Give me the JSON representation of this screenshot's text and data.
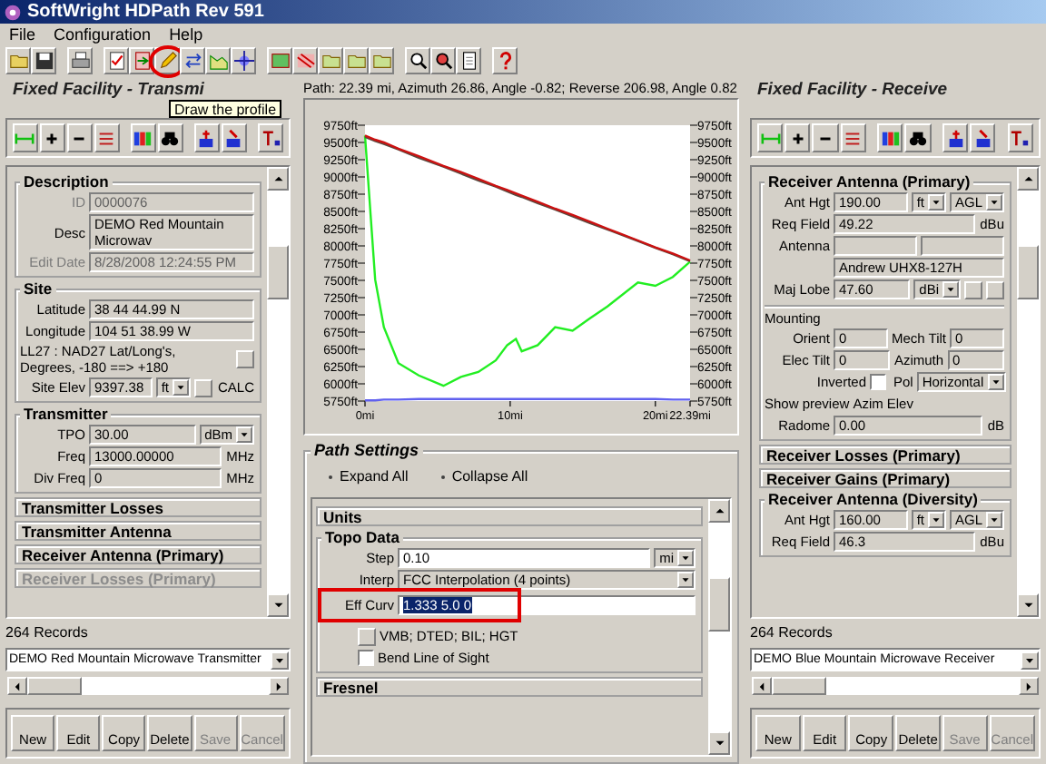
{
  "window": {
    "title": "SoftWright HDPath Rev 591"
  },
  "menu": [
    "File",
    "Configuration",
    "Help"
  ],
  "toolbar": {
    "tooltip": "Draw the profile",
    "highlighted": true
  },
  "transmit_panel": {
    "title": "Fixed Facility - Transmi",
    "sections": [
      {
        "title": "Description",
        "expanded": true,
        "disabled": false,
        "rows": [
          [
            {
              "kind": "label",
              "text": "ID",
              "disabled": true
            },
            {
              "kind": "input",
              "value": "0000076",
              "editable": false,
              "disabled": true
            }
          ],
          [
            {
              "kind": "label",
              "text": "Desc",
              "disabled": false
            },
            {
              "kind": "input",
              "value": "DEMO Red Mountain Microwav",
              "editable": false,
              "disabled": false
            }
          ],
          [
            {
              "kind": "label",
              "text": "Edit Date",
              "disabled": true
            },
            {
              "kind": "input",
              "value": "8/28/2008 12:24:55 PM",
              "editable": false,
              "disabled": true
            }
          ]
        ]
      },
      {
        "title": "Site",
        "expanded": true,
        "disabled": false,
        "rows": [
          [
            {
              "kind": "label",
              "text": "Latitude"
            },
            {
              "kind": "input",
              "value": "38 44 44.99 N",
              "editable": false
            }
          ],
          [
            {
              "kind": "label",
              "text": "Longitude"
            },
            {
              "kind": "input",
              "value": "104 51 38.99 W",
              "editable": false
            }
          ],
          [
            {
              "kind": "caption",
              "text": "LL27 : NAD27 Lat/Long's, Degrees, -180 ==> +180"
            },
            {
              "kind": "button"
            }
          ],
          [
            {
              "kind": "label",
              "text": "Site Elev"
            },
            {
              "kind": "input",
              "value": "9397.38",
              "editable": false
            },
            {
              "kind": "combo",
              "value": "ft"
            },
            {
              "kind": "button"
            },
            {
              "kind": "unit",
              "text": "CALC"
            }
          ]
        ]
      },
      {
        "title": "Transmitter",
        "expanded": true,
        "disabled": false,
        "rows": [
          [
            {
              "kind": "label",
              "text": "TPO"
            },
            {
              "kind": "input",
              "value": "30.00",
              "editable": false
            },
            {
              "kind": "combo",
              "value": "dBm"
            }
          ],
          [
            {
              "kind": "label",
              "text": "Freq"
            },
            {
              "kind": "input",
              "value": "13000.00000",
              "editable": false
            },
            {
              "kind": "unit",
              "text": "MHz"
            }
          ],
          [
            {
              "kind": "label",
              "text": "Div Freq"
            },
            {
              "kind": "input",
              "value": "0",
              "editable": false
            },
            {
              "kind": "unit",
              "text": "MHz"
            }
          ]
        ]
      },
      {
        "title": "Transmitter Losses",
        "expanded": false,
        "disabled": false
      },
      {
        "title": "Transmitter Antenna",
        "expanded": false,
        "disabled": false
      },
      {
        "title": "Receiver Antenna (Primary)",
        "expanded": false,
        "disabled": false
      },
      {
        "title": "Receiver Losses (Primary)",
        "expanded": false,
        "disabled": true
      }
    ],
    "records": "264 Records",
    "record": "DEMO Red Mountain Microwave Transmitter",
    "buttons": [
      {
        "label": "New",
        "disabled": false
      },
      {
        "label": "Edit",
        "disabled": false
      },
      {
        "label": "Copy",
        "disabled": false
      },
      {
        "label": "Delete",
        "disabled": false
      },
      {
        "label": "Save",
        "disabled": true
      },
      {
        "label": "Cancel",
        "disabled": true
      }
    ]
  },
  "profile": {
    "path_info": "Path: 22.39 mi, Azimuth 26.86, Angle -0.82; Reverse 206.98, Angle 0.82",
    "chart_data": {
      "type": "line",
      "x": [
        0,
        0.7,
        1.3,
        2.3,
        3.7,
        5.4,
        6.6,
        7.8,
        9,
        9.8,
        10.4,
        10.8,
        11.9,
        13.1,
        14.3,
        15.5,
        16.7,
        18.8,
        20,
        21.2,
        22.39
      ],
      "series": [
        {
          "color": "#22ee22",
          "values": [
            9600,
            7510,
            6820,
            6300,
            6120,
            5970,
            6100,
            6170,
            6340,
            6560,
            6650,
            6470,
            6560,
            6820,
            6770,
            6950,
            7120,
            7470,
            7420,
            7550,
            7770
          ]
        },
        {
          "color": "#5a4a40",
          "values": [
            9580,
            9520,
            9480,
            9400,
            9280,
            9150,
            9050,
            8950,
            8860,
            8790,
            8740,
            8710,
            8620,
            8530,
            8430,
            8330,
            8240,
            8070,
            7970,
            7880,
            7780
          ]
        },
        {
          "color": "#cc1111",
          "values": [
            9600,
            9540,
            9500,
            9410,
            9300,
            9160,
            9070,
            8970,
            8870,
            8810,
            8760,
            8730,
            8640,
            8540,
            8450,
            8350,
            8250,
            8080,
            7980,
            7890,
            7790
          ]
        },
        {
          "color": "#6060ee",
          "values": [
            5760,
            5760,
            5770,
            5770,
            5780,
            5780,
            5780,
            5780,
            5780,
            5780,
            5780,
            5780,
            5780,
            5780,
            5780,
            5780,
            5780,
            5780,
            5780,
            5770,
            5770
          ]
        }
      ],
      "xlim": [
        0,
        22.39
      ],
      "ylim": [
        5750,
        9750
      ],
      "xticks": [
        {
          "value": 0,
          "label": "0mi"
        },
        {
          "value": 10,
          "label": "10mi"
        },
        {
          "value": 20,
          "label": "20mi"
        },
        {
          "value": 22.39,
          "label": "22.39mi"
        }
      ],
      "yticks": [
        {
          "value": 9750,
          "label": "9750ft"
        },
        {
          "value": 9500,
          "label": "9500ft"
        },
        {
          "value": 9250,
          "label": "9250ft"
        },
        {
          "value": 9000,
          "label": "9000ft"
        },
        {
          "value": 8750,
          "label": "8750ft"
        },
        {
          "value": 8500,
          "label": "8500ft"
        },
        {
          "value": 8250,
          "label": "8250ft"
        },
        {
          "value": 8000,
          "label": "8000ft"
        },
        {
          "value": 7750,
          "label": "7750ft"
        },
        {
          "value": 7500,
          "label": "7500ft"
        },
        {
          "value": 7250,
          "label": "7250ft"
        },
        {
          "value": 7000,
          "label": "7000ft"
        },
        {
          "value": 6750,
          "label": "6750ft"
        },
        {
          "value": 6500,
          "label": "6500ft"
        },
        {
          "value": 6250,
          "label": "6250ft"
        },
        {
          "value": 6000,
          "label": "6000ft"
        },
        {
          "value": 5750,
          "label": "5750ft"
        }
      ]
    }
  },
  "path_settings": {
    "title": "Path Settings",
    "links": [
      "Expand All",
      "Collapse All"
    ],
    "sections": [
      {
        "title": "Units",
        "expanded": false,
        "disabled": false
      },
      {
        "title": "Topo Data",
        "expanded": true,
        "disabled": false,
        "rows": [
          [
            {
              "kind": "label",
              "text": "Step"
            },
            {
              "kind": "input",
              "value": "0.10",
              "editable": true
            },
            {
              "kind": "combo",
              "value": "mi"
            }
          ],
          [
            {
              "kind": "label",
              "text": "Interp"
            },
            {
              "kind": "combo",
              "value": "FCC Interpolation (4 points)"
            }
          ],
          [
            {
              "kind": "label",
              "text": "Eff Curv"
            },
            {
              "kind": "input",
              "value": "1.333 5.0 0",
              "editable": true,
              "selected": true,
              "highlighted": true
            }
          ],
          [
            {
              "kind": "button"
            },
            {
              "kind": "caption",
              "text": "VMB; DTED; BIL; HGT"
            }
          ],
          [
            {
              "kind": "check",
              "checked": false
            },
            {
              "kind": "caption",
              "text": "Bend Line of Sight"
            }
          ]
        ]
      },
      {
        "title": "Fresnel",
        "expanded": false,
        "disabled": false
      }
    ]
  },
  "receive_panel": {
    "title": "Fixed Facility - Receive",
    "sections": [
      {
        "title": "Receiver Antenna (Primary)",
        "expanded": true,
        "disabled": false,
        "rows": [
          [
            {
              "kind": "label",
              "text": "Ant Hgt"
            },
            {
              "kind": "input",
              "value": "190.00",
              "editable": false
            },
            {
              "kind": "combo",
              "value": "ft"
            },
            {
              "kind": "combo",
              "value": "AGL"
            }
          ],
          [
            {
              "kind": "label",
              "text": "Req Field"
            },
            {
              "kind": "input",
              "value": "49.22",
              "editable": false
            },
            {
              "kind": "unit",
              "text": "dBu"
            }
          ],
          [
            {
              "kind": "label",
              "text": "Antenna"
            },
            {
              "kind": "input",
              "editable": false
            },
            {
              "kind": "input",
              "editable": false
            }
          ],
          [
            {
              "kind": "label",
              "text": ""
            },
            {
              "kind": "input",
              "value": "Andrew UHX8-127H",
              "editable": false
            }
          ],
          [
            {
              "kind": "label",
              "text": "Maj Lobe"
            },
            {
              "kind": "input",
              "value": "47.60",
              "editable": false
            },
            {
              "kind": "combo",
              "value": "dBi"
            },
            {
              "kind": "button"
            },
            {
              "kind": "button"
            }
          ]
        ],
        "subgroup": {
          "title": "Mounting",
          "rows": [
            [
              {
                "kind": "label",
                "text": "Orient"
              },
              {
                "kind": "input",
                "value": "0",
                "editable": false
              },
              {
                "kind": "label",
                "text": "Mech Tilt"
              },
              {
                "kind": "input",
                "value": "0",
                "editable": false
              }
            ],
            [
              {
                "kind": "label",
                "text": "Elec Tilt"
              },
              {
                "kind": "input",
                "value": "0",
                "editable": false
              },
              {
                "kind": "label",
                "text": "Azimuth"
              },
              {
                "kind": "input",
                "value": "0",
                "editable": false
              }
            ],
            [
              {
                "kind": "check",
                "label": "Inverted",
                "checked": false
              },
              {
                "kind": "label",
                "text": ""
              },
              {
                "kind": "label",
                "text": "Pol"
              },
              {
                "kind": "combo",
                "value": "Horizontal"
              }
            ],
            [
              {
                "kind": "caption",
                "text": "Show preview"
              },
              {
                "kind": "caption",
                "text": "Azim"
              },
              {
                "kind": "caption",
                "text": "Elev"
              }
            ],
            [
              {
                "kind": "label",
                "text": "Radome"
              },
              {
                "kind": "input",
                "value": "0.00",
                "editable": false
              },
              {
                "kind": "unit",
                "text": "dB"
              }
            ]
          ]
        }
      },
      {
        "title": "Receiver Losses (Primary)",
        "expanded": false,
        "disabled": false
      },
      {
        "title": "Receiver Gains (Primary)",
        "expanded": false,
        "disabled": false
      },
      {
        "title": "Receiver Antenna (Diversity)",
        "expanded": true,
        "disabled": false,
        "rows": [
          [
            {
              "kind": "label",
              "text": "Ant Hgt"
            },
            {
              "kind": "input",
              "value": "160.00",
              "editable": false
            },
            {
              "kind": "combo",
              "value": "ft"
            },
            {
              "kind": "combo",
              "value": "AGL"
            }
          ],
          [
            {
              "kind": "label",
              "text": "Req Field"
            },
            {
              "kind": "input",
              "value": "46.3",
              "editable": false
            },
            {
              "kind": "unit",
              "text": "dBu"
            }
          ]
        ]
      }
    ],
    "records": "264 Records",
    "record": "DEMO Blue Mountain Microwave Receiver",
    "buttons": [
      {
        "label": "New",
        "disabled": false
      },
      {
        "label": "Edit",
        "disabled": false
      },
      {
        "label": "Copy",
        "disabled": false
      },
      {
        "label": "Delete",
        "disabled": false
      },
      {
        "label": "Save",
        "disabled": true
      },
      {
        "label": "Cancel",
        "disabled": true
      }
    ]
  }
}
